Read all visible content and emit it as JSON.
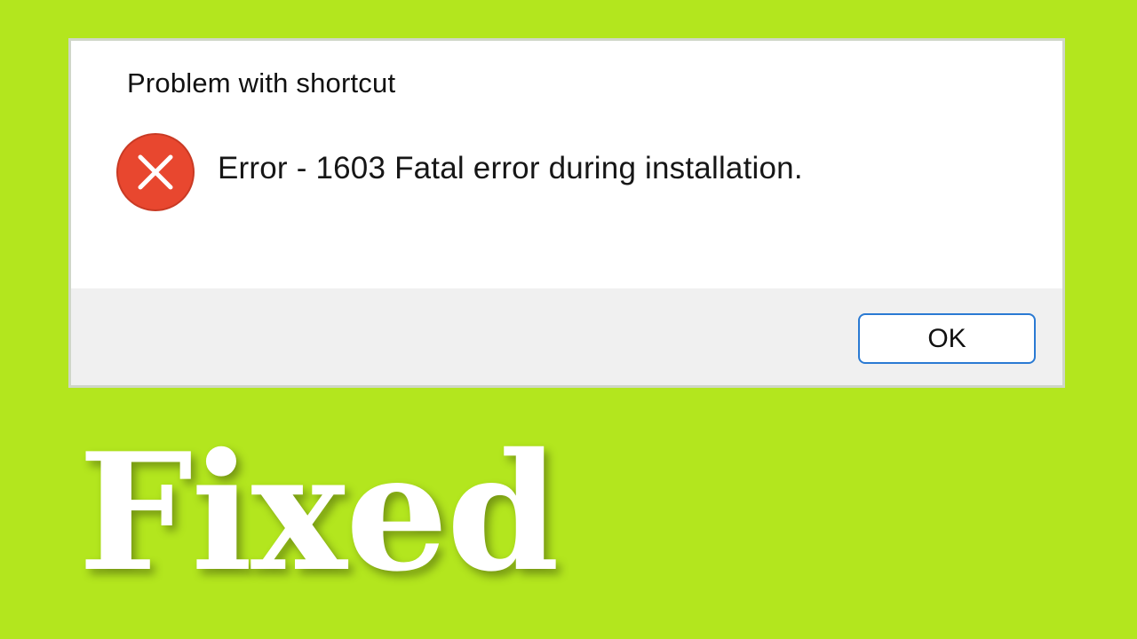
{
  "background_color": "#b3e61e",
  "dialog": {
    "title": "Problem with shortcut",
    "icon": "error-circle-x-icon",
    "icon_color": "#e8472f",
    "message": "Error - 1603 Fatal error during installation.",
    "ok_label": "OK",
    "button_border_color": "#2a7ad3"
  },
  "headline": {
    "text": "Fixed",
    "color": "#ffffff"
  }
}
